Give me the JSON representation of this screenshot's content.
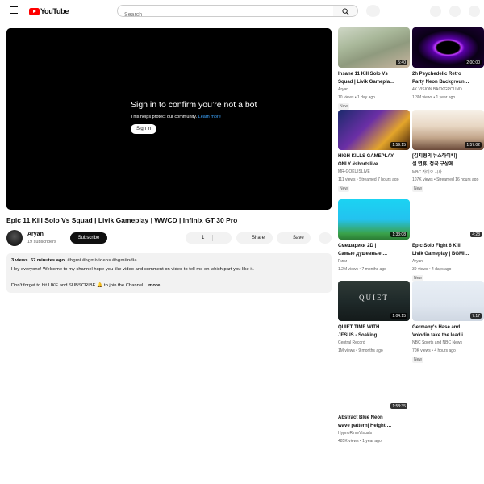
{
  "header": {
    "logo_text": "YouTube",
    "search_placeholder": "Search",
    "brand_color": "#ff0000"
  },
  "player": {
    "heading": "Sign in to confirm you’re not a bot",
    "subtext": "This helps protect our community.",
    "learn_more": "Learn more",
    "signin_label": "Sign in"
  },
  "video": {
    "title": "Epic 11 Kill Solo Vs Squad | Livik Gameplay | WWCD | Infinix GT 30 Pro",
    "channel": "Aryan",
    "subscribers": "19 subscribers",
    "subscribe_label": "Subscribe",
    "likes": "1",
    "share_label": "Share",
    "save_label": "Save"
  },
  "description": {
    "views": "3 views",
    "age": "57 minutes ago",
    "tags": "#bgmi #bgmivideos #bgmiindia",
    "line2": "Hey everyone! Welcome to my channel hope you like video and comment on video to tell me on which part you like it.",
    "line3": "Don't forget to hit LIKE and SUBSCRIBE 🔔 to join the Channel",
    "more_label": "...more"
  },
  "recommendations": [
    {
      "title1": "Insane 11 Kill Solo Vs",
      "title2": "Squad | Livik Gamepla…",
      "channel": "Aryan",
      "views": "10 views",
      "age": "1 day ago",
      "badge": "New",
      "duration": "5:40"
    },
    {
      "title1": "2h Psychedelic Retro",
      "title2": "Party Neon Backgroun…",
      "channel": "4K VISION BACKGROUND",
      "views": "1.3M views",
      "age": "1 year ago",
      "badge": "",
      "duration": "2:00:00"
    },
    {
      "title1": "HIGH KILLS GAMEPLAY",
      "title2": "ONLY #shortslive …",
      "channel": "MR-GOKUISLIVE",
      "views": "111 views",
      "age": "Streamed 7 hours ago",
      "badge": "New",
      "duration": "1:59:15"
    },
    {
      "title1": "[김치형의 뉴스하이킥]",
      "title2": "설 연휴, 정국 구상에 …",
      "channel": "MBC 라디오 시사",
      "views": "107K views",
      "age": "Streamed 16 hours ago",
      "badge": "New",
      "duration": "1:57:02"
    },
    {
      "title1": "Смешарики 2D |",
      "title2": "Самые душевные …",
      "channel": "Рики",
      "views": "1.2M views",
      "age": "7 months ago",
      "badge": "",
      "duration": "1:33:08"
    },
    {
      "title1": "Epic Solo Fight 6 Kill",
      "title2": "Livik Gameplay | BGMI…",
      "channel": "Aryan",
      "views": "39 views",
      "age": "4 days ago",
      "badge": "New",
      "duration": "4:28"
    },
    {
      "title1": "QUIET TIME WITH",
      "title2": "JESUS - Soaking …",
      "channel": "Central Record",
      "views": "1M views",
      "age": "9 months ago",
      "badge": "",
      "duration": "1:04:15",
      "thumb_text": "QUIET"
    },
    {
      "title1": "Germany's Hase and",
      "title2": "Volodin take the lead i…",
      "channel": "NBC Sports and NBC News",
      "views": "70K views",
      "age": "4 hours ago",
      "badge": "New",
      "duration": "7:17"
    },
    {
      "title1": "Abstract Blue Neon",
      "title2": "wave pattern| Height …",
      "channel": "HypnoRimeVisuals",
      "views": "485K views",
      "age": "1 year ago",
      "badge": "",
      "duration": "1:58:35"
    }
  ]
}
